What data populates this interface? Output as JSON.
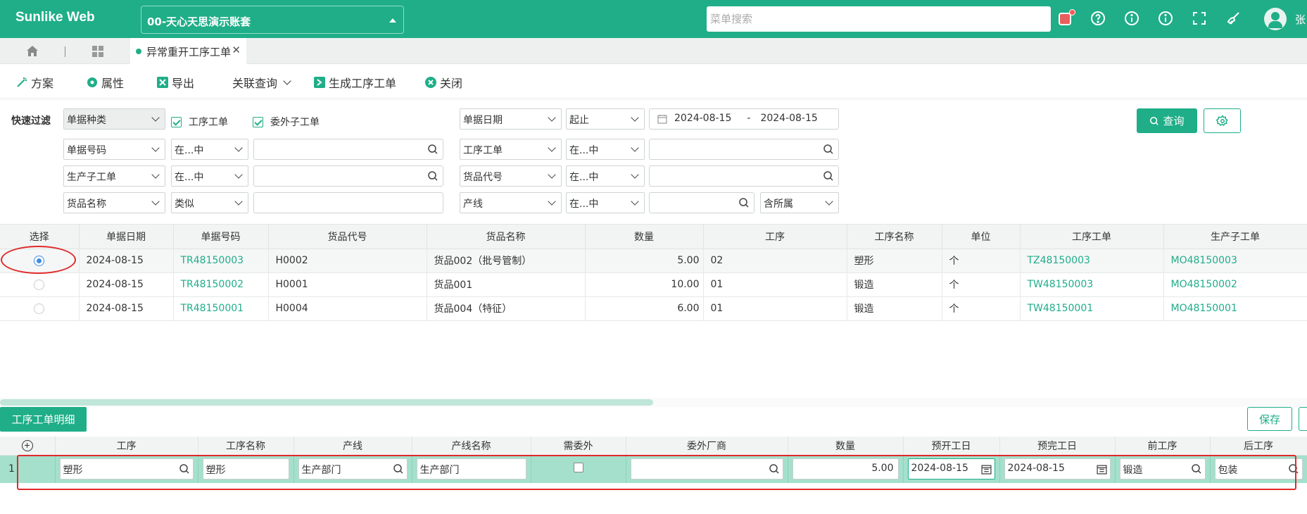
{
  "header": {
    "brand": "Sunlike Web",
    "account": "00-天心天思演示账套",
    "menu_search_placeholder": "菜单搜索",
    "user": "张"
  },
  "tabs": {
    "active": "异常重开工序工单"
  },
  "toolbar": {
    "plan": "方案",
    "props": "属性",
    "export": "导出",
    "related": "关联查询",
    "generate": "生成工序工单",
    "close": "关闭"
  },
  "filter": {
    "label": "快速过滤",
    "doc_type": "单据种类",
    "chk_process": "工序工单",
    "chk_outsource": "委外子工单",
    "date_field": "单据日期",
    "date_op": "起止",
    "date_from": "2024-08-15",
    "date_sep": "-",
    "date_to": "2024-08-15",
    "row2": {
      "field": "单据号码",
      "op": "在...中",
      "field2": "工序工单",
      "op2": "在...中"
    },
    "row3": {
      "field": "生产子工单",
      "op": "在...中",
      "field2": "货品代号",
      "op2": "在...中"
    },
    "row4": {
      "field": "货品名称",
      "op": "类似",
      "field2": "产线",
      "op2": "在...中",
      "extra": "含所属"
    },
    "query_btn": "查询"
  },
  "main_grid": {
    "columns": [
      "选择",
      "单据日期",
      "单据号码",
      "货品代号",
      "货品名称",
      "数量",
      "工序",
      "工序名称",
      "单位",
      "工序工单",
      "生产子工单"
    ],
    "rows": [
      [
        "2024-08-15",
        "TR48150003",
        "H0002",
        "货品002（批号管制）",
        "5.00",
        "02",
        "塑形",
        "个",
        "TZ48150003",
        "MO48150003"
      ],
      [
        "2024-08-15",
        "TR48150002",
        "H0001",
        "货品001",
        "10.00",
        "01",
        "锻造",
        "个",
        "TW48150003",
        "MO48150002"
      ],
      [
        "2024-08-15",
        "TR48150001",
        "H0004",
        "货品004（特征）",
        "6.00",
        "01",
        "锻造",
        "个",
        "TW48150001",
        "MO48150001"
      ]
    ],
    "selected_row": 0
  },
  "detail": {
    "tab": "工序工单明细",
    "save": "保存",
    "columns": [
      "工序",
      "工序名称",
      "产线",
      "产线名称",
      "需委外",
      "委外厂商",
      "数量",
      "预开工日",
      "预完工日",
      "前工序",
      "后工序"
    ],
    "row": {
      "seq": "1",
      "process": "塑形",
      "process_name": "塑形",
      "line": "生产部门",
      "line_name": "生产部门",
      "outsource": false,
      "vendor": "",
      "qty": "5.00",
      "start": "2024-08-15",
      "finish": "2024-08-15",
      "prev": "锻造",
      "next": "包装"
    }
  },
  "colors": {
    "brand": "#1fae88",
    "highlight_row": "#a4e0cc",
    "annotation": "#e02a2a"
  }
}
